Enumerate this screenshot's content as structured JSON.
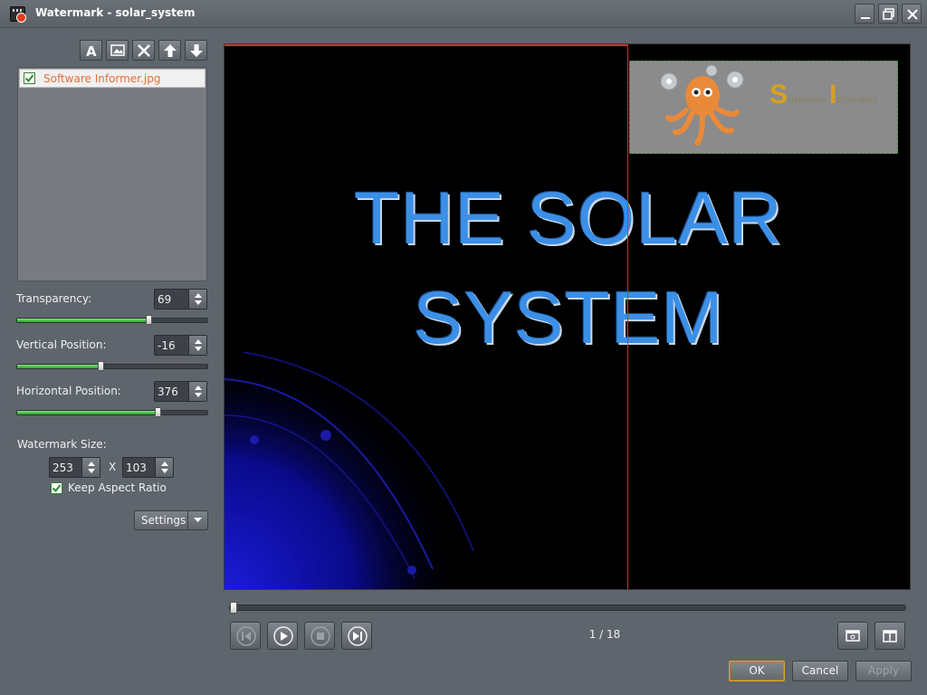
{
  "window": {
    "title": "Watermark - solar_system"
  },
  "toolbar": {
    "buttons": [
      "add-text",
      "add-image",
      "delete",
      "move-up",
      "move-down"
    ]
  },
  "watermark_list": {
    "items": [
      {
        "label": "Software Informer.jpg",
        "checked": true
      }
    ]
  },
  "transparency": {
    "label": "Transparency:",
    "value": "69",
    "fraction": 0.69
  },
  "vertical_position": {
    "label": "Vertical Position:",
    "value": "-16",
    "fraction": 0.44
  },
  "horizontal_position": {
    "label": "Horizontal Position:",
    "value": "376",
    "fraction": 0.74
  },
  "watermark_size": {
    "label": "Watermark Size:",
    "width": "253",
    "separator": "X",
    "height": "103",
    "keep_aspect_label": "Keep Aspect Ratio",
    "keep_aspect_checked": true
  },
  "settings": {
    "label": "Settings"
  },
  "preview": {
    "title_line1": "THE SOLAR",
    "title_line2": "SYSTEM",
    "watermark_text_s": "S",
    "watermark_text_oftware": "oftware ",
    "watermark_text_i": "I",
    "watermark_text_nformer": "nformer"
  },
  "playback": {
    "page_indicator": "1 / 18",
    "position_fraction": 0.0
  },
  "dialog": {
    "ok_label": "OK",
    "cancel_label": "Cancel",
    "apply_label": "Apply"
  },
  "colors": {
    "accent_green": "#27a527",
    "title_blue": "#3b8fe6",
    "ok_focus": "#e0a030"
  }
}
